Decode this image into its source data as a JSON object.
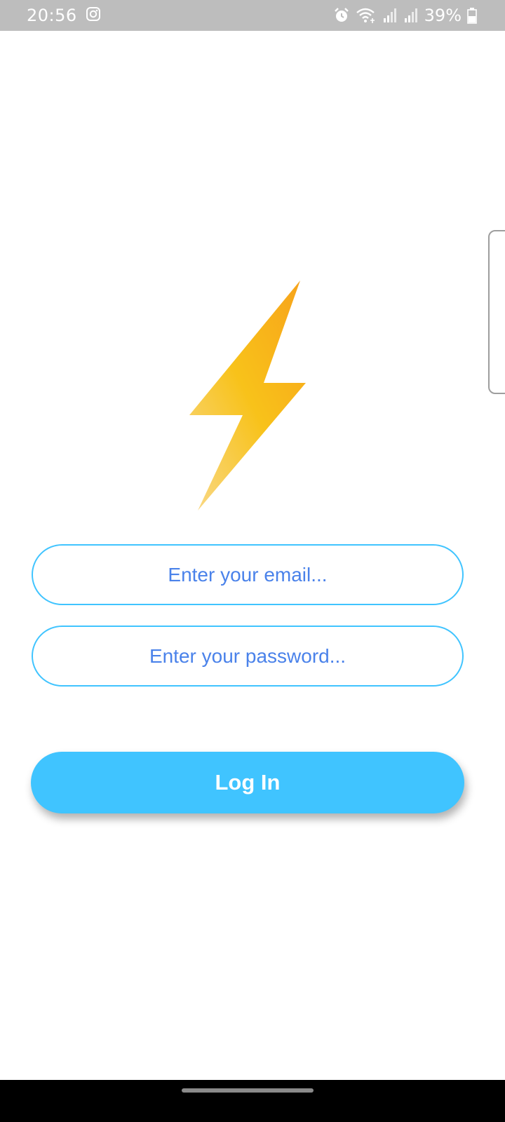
{
  "status_bar": {
    "time": "20:56",
    "battery_percent": "39%",
    "icons": [
      "instagram-icon",
      "alarm-icon",
      "wifi-icon",
      "signal-icon",
      "signal-icon",
      "battery-icon"
    ]
  },
  "login": {
    "logo_icon": "lightning-bolt-icon",
    "email_placeholder": "Enter your email...",
    "password_placeholder": "Enter your password...",
    "login_button_label": "Log In"
  },
  "colors": {
    "accent": "#40c4ff",
    "placeholder_text": "#4a82ea",
    "logo_gradient": [
      "#f7a21b",
      "#f8c21a",
      "#f9d98a"
    ],
    "status_bar": "#bdbdbd",
    "nav_bar": "#000000"
  }
}
